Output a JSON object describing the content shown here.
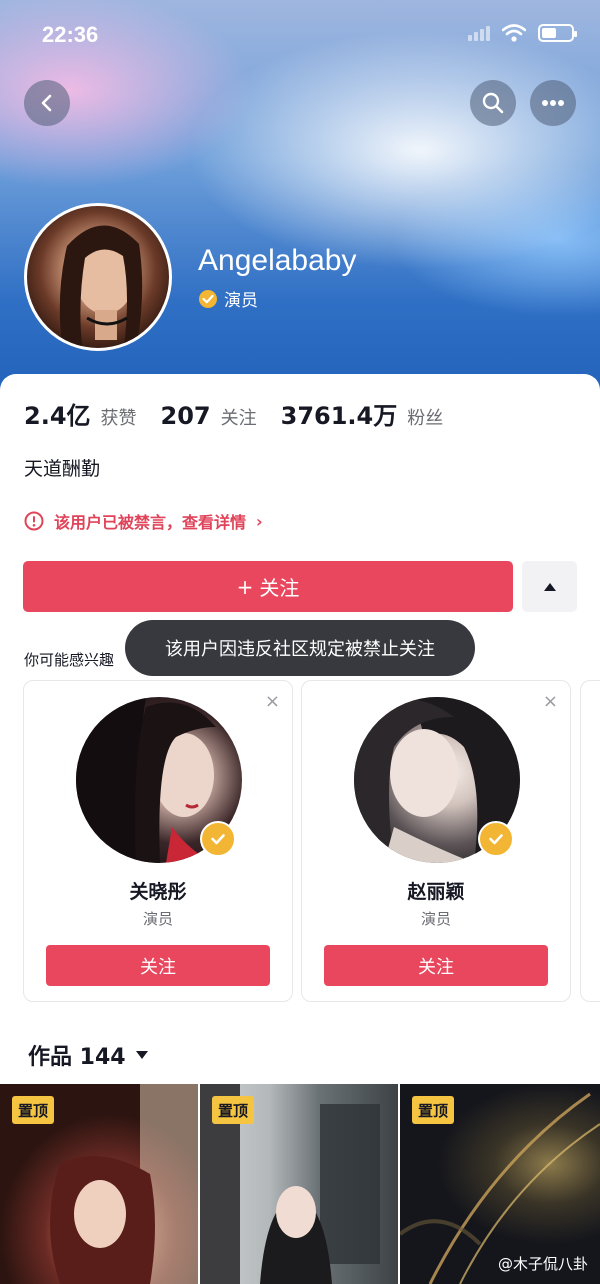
{
  "status_bar": {
    "time": "22:36"
  },
  "profile": {
    "name": "Angelababy",
    "verification": "演员",
    "bio": "天道酬勤"
  },
  "stats": [
    {
      "value": "2.4亿",
      "label": "获赞"
    },
    {
      "value": "207",
      "label": "关注"
    },
    {
      "value": "3761.4万",
      "label": "粉丝"
    }
  ],
  "ban_notice": {
    "text": "该用户已被禁言，查看详情",
    "arrow": "›"
  },
  "follow_button": {
    "plus": "+",
    "label": "关注"
  },
  "toast": "该用户因违反社区规定被禁止关注",
  "suggestions": {
    "title": "你可能感兴趣",
    "cards": [
      {
        "name": "关晓彤",
        "role": "演员",
        "button": "关注",
        "close": "×"
      },
      {
        "name": "赵丽颖",
        "role": "演员",
        "button": "关注",
        "close": "×"
      }
    ]
  },
  "works": {
    "title": "作品 144",
    "pin_label": "置顶",
    "watermark": "@木子侃八卦"
  },
  "colors": {
    "accent": "#e8475e",
    "badge": "#f2b534",
    "pin": "#f5c542",
    "ban": "#e0445a"
  },
  "icons": [
    "back-arrow-icon",
    "search-icon",
    "more-icon",
    "verified-icon",
    "expand-icon",
    "close-icon",
    "wifi-icon",
    "battery-icon"
  ]
}
